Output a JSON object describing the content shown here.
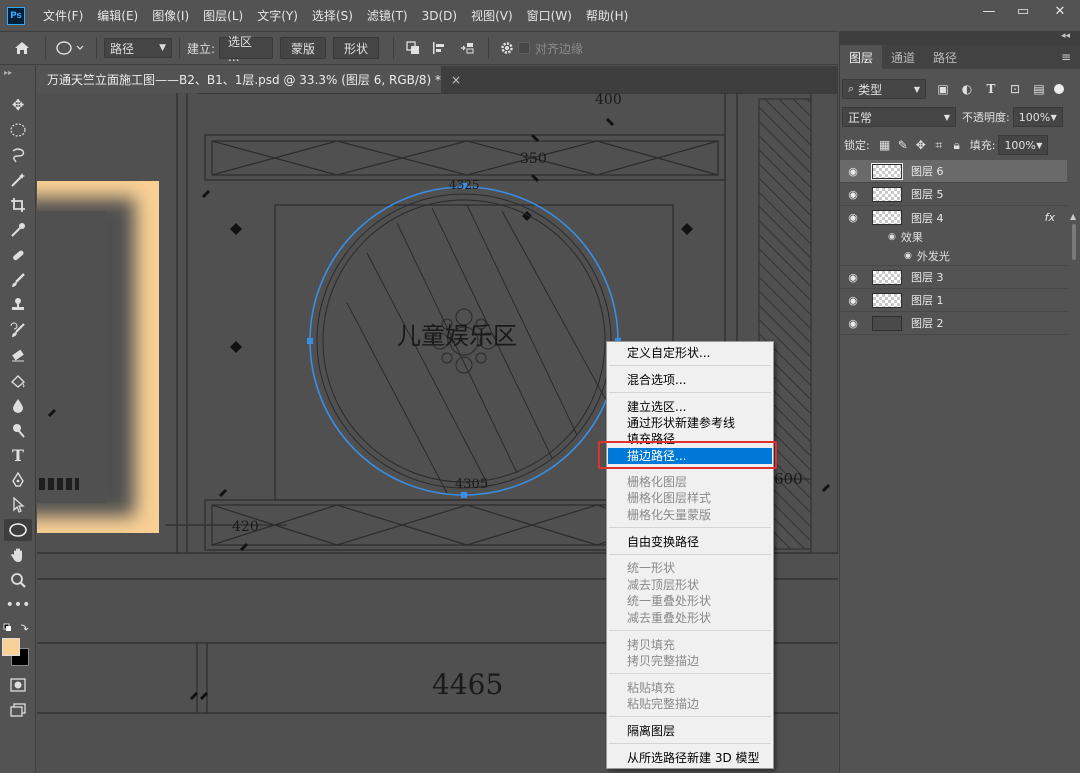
{
  "app": {
    "logo": "Ps"
  },
  "menubar": {
    "items": [
      "文件(F)",
      "编辑(E)",
      "图像(I)",
      "图层(L)",
      "文字(Y)",
      "选择(S)",
      "滤镜(T)",
      "3D(D)",
      "视图(V)",
      "窗口(W)",
      "帮助(H)"
    ],
    "window_controls": {
      "minimize": "—",
      "restore": "▭",
      "close": "✕"
    }
  },
  "options": {
    "mode_value": "路径",
    "make_label": "建立:",
    "selection_button": "选区 ...",
    "mask_button": "蒙版",
    "shape_button": "形状",
    "align_edges_label": "对齐边缘"
  },
  "document": {
    "tab_title": "万通天竺立面施工图——B2、B1、1层.psd @ 33.3% (图层 6, RGB/8) *",
    "close": "×"
  },
  "drawing": {
    "labels": [
      "400",
      "350",
      "4325",
      "儿童娱乐区",
      "4305",
      "420",
      "600",
      "4465"
    ]
  },
  "context_menu": {
    "items": [
      {
        "label": "定义自定形状...",
        "disabled": false
      },
      {
        "label": "混合选项...",
        "disabled": false
      },
      {
        "label": "建立选区...",
        "disabled": false
      },
      {
        "label": "通过形状新建参考线",
        "disabled": false
      },
      {
        "label": "填充路径...",
        "disabled": false
      },
      {
        "label": "描边路径...",
        "disabled": false,
        "selected": true
      },
      {
        "label": "栅格化图层",
        "disabled": true
      },
      {
        "label": "栅格化图层样式",
        "disabled": true
      },
      {
        "label": "栅格化矢量蒙版",
        "disabled": true
      },
      {
        "label": "自由变换路径",
        "disabled": false
      },
      {
        "label": "统一形状",
        "disabled": true
      },
      {
        "label": "减去顶层形状",
        "disabled": true
      },
      {
        "label": "统一重叠处形状",
        "disabled": true
      },
      {
        "label": "减去重叠处形状",
        "disabled": true
      },
      {
        "label": "拷贝填充",
        "disabled": true
      },
      {
        "label": "拷贝完整描边",
        "disabled": true
      },
      {
        "label": "粘贴填充",
        "disabled": true
      },
      {
        "label": "粘贴完整描边",
        "disabled": true
      },
      {
        "label": "隔离图层",
        "disabled": false
      },
      {
        "label": "从所选路径新建 3D 模型",
        "disabled": false
      }
    ]
  },
  "layers_panel": {
    "tabs": [
      "图层",
      "通道",
      "路径"
    ],
    "menu_icon": "≡",
    "filter_value": "类型",
    "blend_mode": "正常",
    "opacity_label": "不透明度:",
    "opacity_value": "100%",
    "lock_label": "锁定:",
    "fill_label": "填充:",
    "fill_value": "100%",
    "layers": [
      "图层 6",
      "图层 5",
      "图层 4",
      "图层 3",
      "图层 1",
      "图层 2"
    ],
    "effects_label": "效果",
    "effect_outer_glow": "外发光",
    "fx": "fx"
  },
  "colors": {
    "foreground": "#f9d095",
    "background": "#000000",
    "selection_highlight": "#0078d7",
    "annotation_box": "#e03030",
    "path_color": "#3a8ee6"
  }
}
